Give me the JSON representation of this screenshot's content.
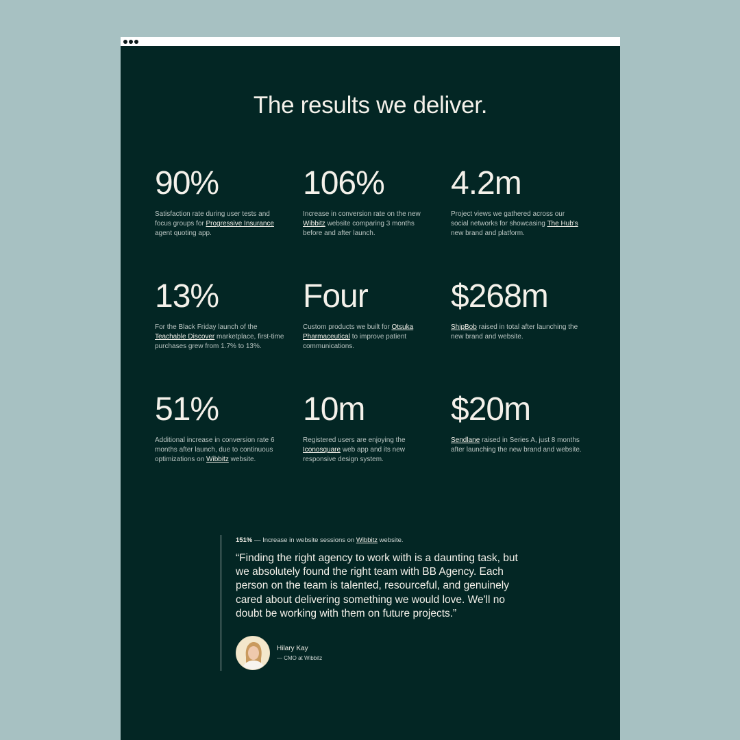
{
  "page": {
    "title": "The results we deliver."
  },
  "stats": [
    {
      "value": "90%",
      "parts": [
        {
          "t": "Satisfaction rate during user tests and focus groups for "
        },
        {
          "t": "Progressive Insurance",
          "link": true
        },
        {
          "t": " agent quoting app."
        }
      ]
    },
    {
      "value": "106%",
      "parts": [
        {
          "t": "Increase in conversion rate on the new "
        },
        {
          "t": "Wibbitz",
          "link": true
        },
        {
          "t": " website comparing 3 months before and after launch."
        }
      ]
    },
    {
      "value": "4.2m",
      "parts": [
        {
          "t": "Project views we gathered across our social networks for showcasing "
        },
        {
          "t": "The Hub's",
          "link": true
        },
        {
          "t": " new brand and platform."
        }
      ]
    },
    {
      "value": "13%",
      "parts": [
        {
          "t": "For the Black Friday launch of the "
        },
        {
          "t": "Teachable Discover",
          "link": true
        },
        {
          "t": " marketplace, first-time purchases grew from 1.7% to 13%."
        }
      ]
    },
    {
      "value": "Four",
      "parts": [
        {
          "t": "Custom products we built for "
        },
        {
          "t": "Otsuka Pharmaceutical",
          "link": true
        },
        {
          "t": " to improve patient communications."
        }
      ]
    },
    {
      "value": "$268m",
      "parts": [
        {
          "t": "ShipBob",
          "link": true
        },
        {
          "t": " raised in total after launching the new brand and website."
        }
      ]
    },
    {
      "value": "51%",
      "parts": [
        {
          "t": "Additional increase in conversion rate 6 months after launch, due to continuous optimizations on "
        },
        {
          "t": "Wibbitz",
          "link": true
        },
        {
          "t": " website."
        }
      ]
    },
    {
      "value": "10m",
      "parts": [
        {
          "t": "Registered users are enjoying the "
        },
        {
          "t": "Iconosquare",
          "link": true
        },
        {
          "t": " web app and its new responsive design system."
        }
      ]
    },
    {
      "value": "$20m",
      "parts": [
        {
          "t": "Sendlane",
          "link": true
        },
        {
          "t": " raised in Series A, just 8 months after launching the new brand and website."
        }
      ]
    }
  ],
  "testimonial": {
    "metric_value": "151%",
    "metric_text": " — Increase in website sessions on ",
    "metric_link": "Wibbitz",
    "metric_suffix": " website.",
    "quote": "“Finding the right agency to work with is a daunting task, but we absolutely found the right team with BB Agency. Each person on the team is talented, resourceful, and genuinely cared about delivering something we would love. We'll no doubt be working with them on future projects.”",
    "author_name": "Hilary Kay",
    "author_role": "— CMO at Wibbitz"
  },
  "colors": {
    "page_bg": "#a7c1c2",
    "window_bg": "#032624",
    "text_light": "#f4f1ea"
  }
}
